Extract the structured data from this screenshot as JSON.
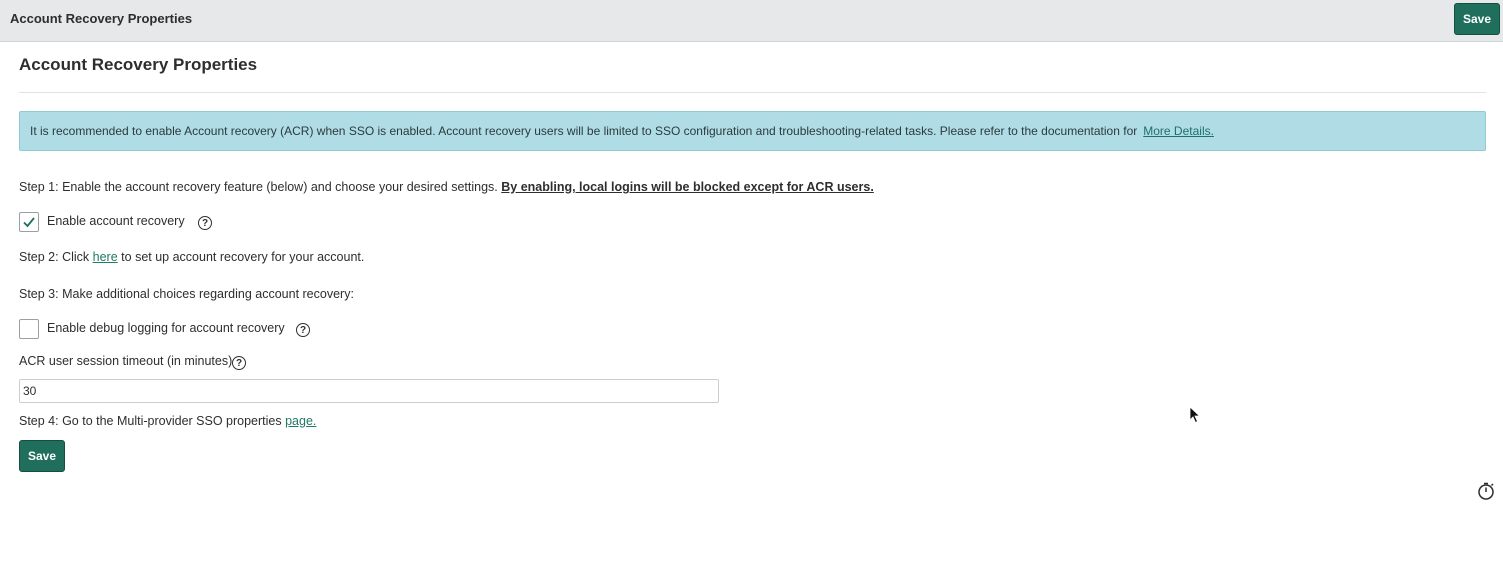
{
  "header": {
    "title": "Account Recovery Properties",
    "save_label": "Save"
  },
  "page": {
    "title": "Account Recovery Properties"
  },
  "alert": {
    "text": "It is recommended to enable Account recovery (ACR) when SSO is enabled. Account recovery users will be limited to SSO configuration and troubleshooting-related tasks. Please refer to the documentation for",
    "link_label": "More Details."
  },
  "step1": {
    "text": "Step 1: Enable the account recovery feature (below) and choose your desired settings.",
    "warning": "By enabling, local logins will be blocked except for ACR users."
  },
  "enable_recovery": {
    "label": "Enable account recovery",
    "checked": true
  },
  "step2": {
    "prefix": "Step 2: Click",
    "link_label": "here",
    "suffix": "to set up account recovery for your account."
  },
  "step3": {
    "text": "Step 3: Make additional choices regarding account recovery:"
  },
  "debug_logging": {
    "label": "Enable debug logging for account recovery",
    "checked": false
  },
  "timeout": {
    "label": "ACR user session timeout (in minutes)",
    "value": "30"
  },
  "step4": {
    "text": "Step 4: Go to the Multi-provider SSO properties",
    "link_label": "page."
  },
  "form": {
    "save_label": "Save"
  },
  "icons": {
    "help": "help-circle-icon",
    "check": "checkmark-icon",
    "cursor": "mouse-pointer-icon",
    "timer": "stopwatch-icon"
  },
  "colors": {
    "primary_button": "#1f6f5c",
    "alert_background": "#b0dde5",
    "link": "#1f7a66",
    "header_background": "#e6e8ea"
  }
}
